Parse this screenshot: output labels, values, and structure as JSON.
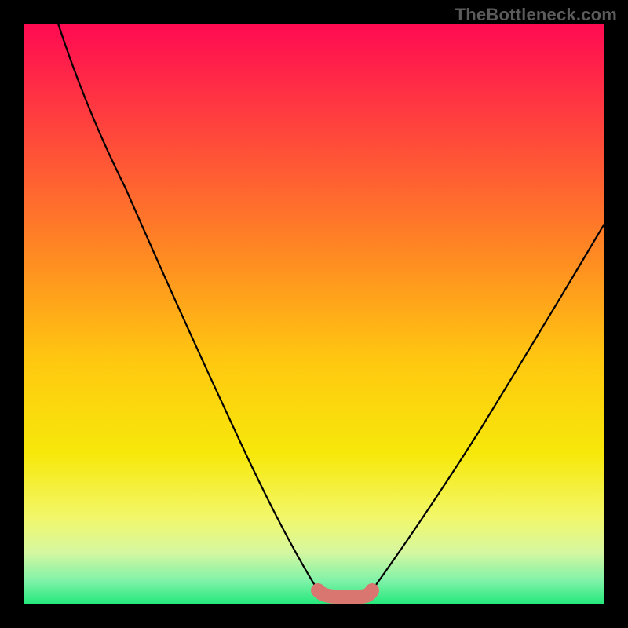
{
  "watermark": "TheBottleneck.com",
  "chart_data": {
    "type": "line",
    "title": "",
    "xlabel": "",
    "ylabel": "",
    "xlim": [
      0,
      100
    ],
    "ylim": [
      0,
      100
    ],
    "series": [
      {
        "name": "curve-left",
        "x": [
          6,
          12,
          18,
          24,
          30,
          36,
          42,
          48,
          51
        ],
        "values": [
          100,
          87,
          74,
          60,
          47,
          34,
          21,
          8,
          2
        ]
      },
      {
        "name": "curve-right",
        "x": [
          60,
          66,
          72,
          78,
          84,
          90,
          96,
          100
        ],
        "values": [
          2,
          12,
          22,
          32,
          42,
          51,
          60,
          66
        ]
      },
      {
        "name": "valley-floor",
        "x": [
          51,
          53,
          56,
          59,
          60
        ],
        "values": [
          2,
          1,
          1,
          1,
          2
        ]
      }
    ],
    "annotations": [
      {
        "type": "highlight-band",
        "name": "valley-highlight",
        "x": [
          51,
          60
        ],
        "y": 2,
        "color": "#d9766f"
      }
    ],
    "background": {
      "type": "vertical-gradient",
      "stops": [
        {
          "offset": 0.0,
          "color": "#ff0a52"
        },
        {
          "offset": 0.2,
          "color": "#ff4a3a"
        },
        {
          "offset": 0.4,
          "color": "#ff8a22"
        },
        {
          "offset": 0.58,
          "color": "#ffc810"
        },
        {
          "offset": 0.74,
          "color": "#f7e80a"
        },
        {
          "offset": 0.85,
          "color": "#f2f76a"
        },
        {
          "offset": 0.91,
          "color": "#d6f7a0"
        },
        {
          "offset": 0.96,
          "color": "#7ef2a8"
        },
        {
          "offset": 1.0,
          "color": "#22e87a"
        }
      ]
    }
  }
}
